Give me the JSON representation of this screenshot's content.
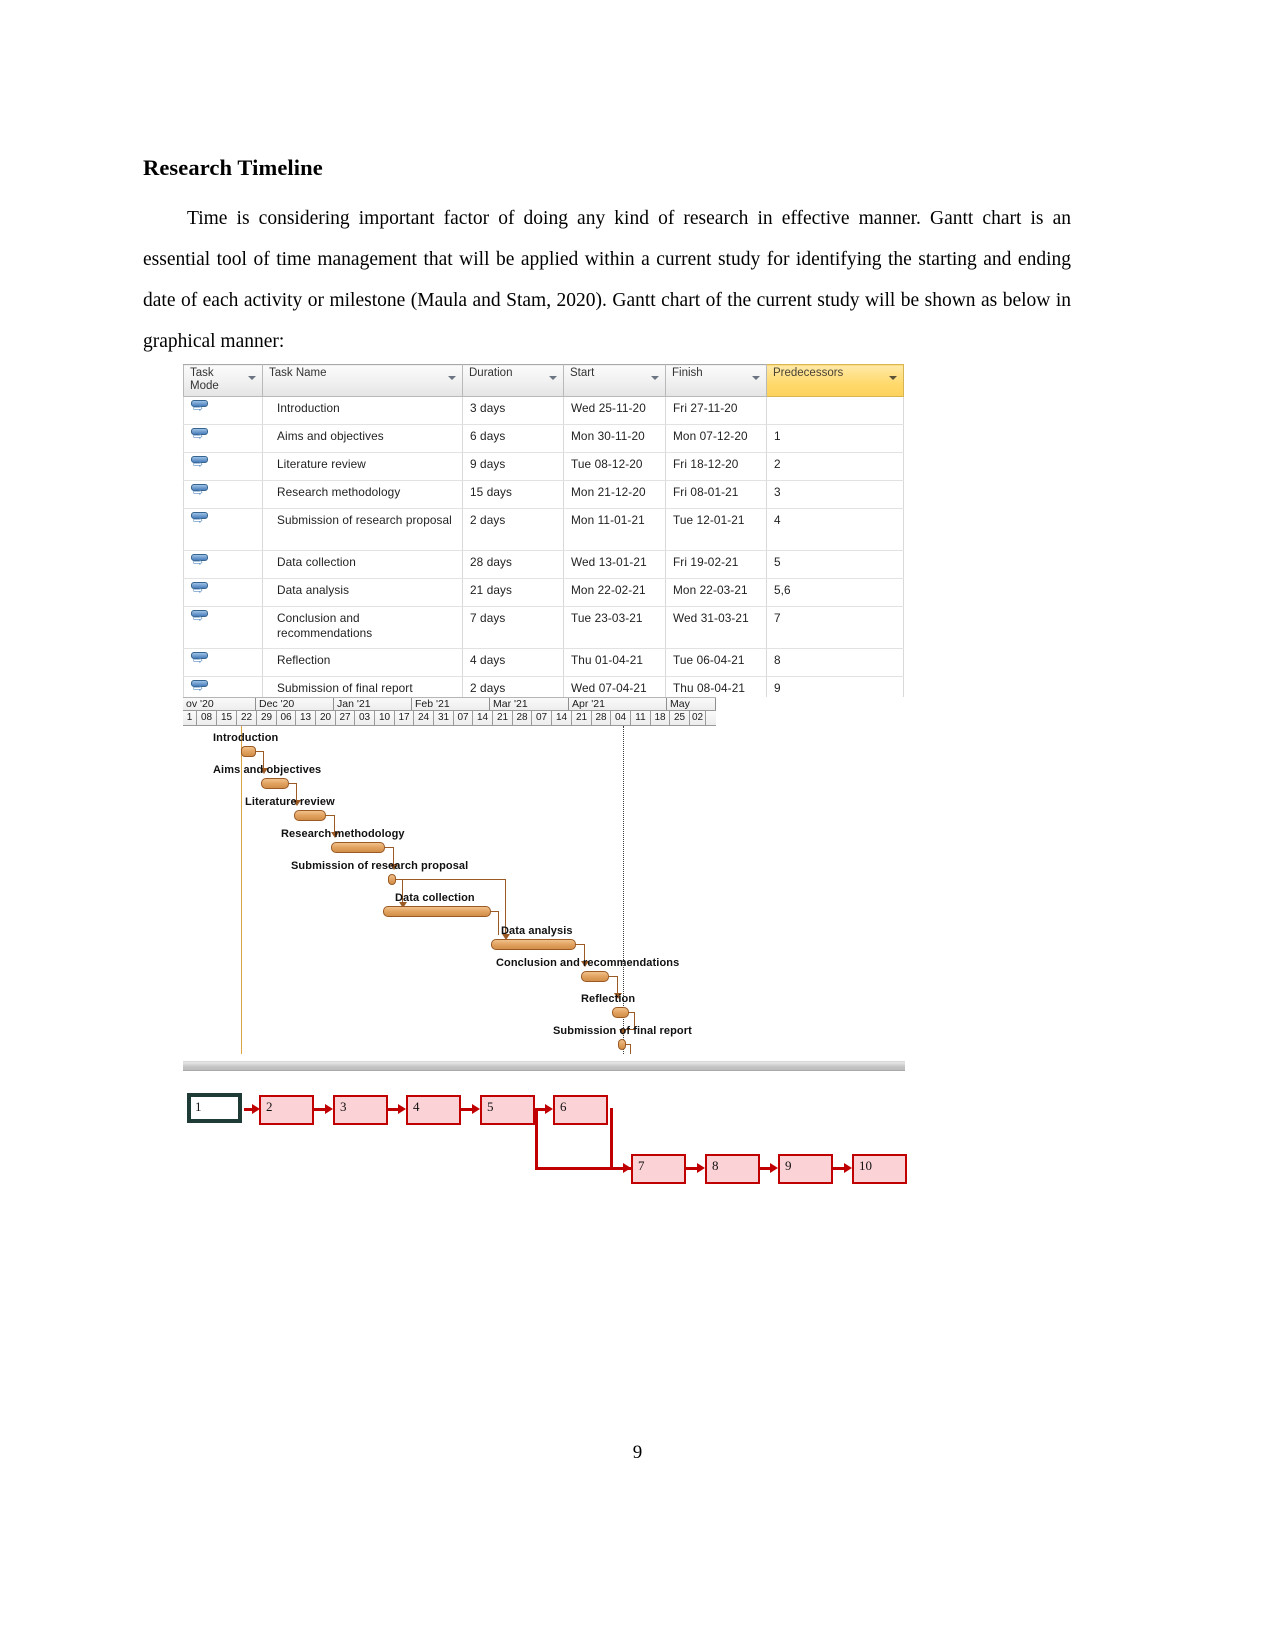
{
  "document": {
    "heading": "Research Timeline",
    "paragraph": "Time is considering important factor of doing any kind of research in effective manner. Gantt chart is an essential tool of time management that will be applied within a current study for identifying the starting and ending date of each activity or milestone (Maula and Stam, 2020). Gantt chart of the current study will be shown as below in graphical manner:",
    "page_number": "9"
  },
  "project_table": {
    "columns": [
      {
        "label": "Task\nMode",
        "filter_icon": "chevron-down-icon"
      },
      {
        "label": "Task Name",
        "filter_icon": "chevron-down-icon"
      },
      {
        "label": "Duration",
        "filter_icon": "chevron-down-icon"
      },
      {
        "label": "Start",
        "filter_icon": "chevron-down-icon"
      },
      {
        "label": "Finish",
        "filter_icon": "chevron-down-icon"
      },
      {
        "label": "Predecessors",
        "filter_icon": "chevron-down-icon"
      }
    ],
    "highlight_column_color": "#ffd96b",
    "rows": [
      {
        "mode_icon": "auto-schedule-icon",
        "name": "Introduction",
        "duration": "3 days",
        "start": "Wed 25-11-20",
        "finish": "Fri 27-11-20",
        "predecessors": ""
      },
      {
        "mode_icon": "auto-schedule-icon",
        "name": "Aims and objectives",
        "duration": "6 days",
        "start": "Mon 30-11-20",
        "finish": "Mon 07-12-20",
        "predecessors": "1"
      },
      {
        "mode_icon": "auto-schedule-icon",
        "name": "Literature review",
        "duration": "9 days",
        "start": "Tue 08-12-20",
        "finish": "Fri 18-12-20",
        "predecessors": "2"
      },
      {
        "mode_icon": "auto-schedule-icon",
        "name": "Research methodology",
        "duration": "15 days",
        "start": "Mon 21-12-20",
        "finish": "Fri 08-01-21",
        "predecessors": "3"
      },
      {
        "mode_icon": "auto-schedule-icon",
        "name": "Submission of research proposal",
        "duration": "2 days",
        "start": "Mon 11-01-21",
        "finish": "Tue 12-01-21",
        "predecessors": "4"
      },
      {
        "mode_icon": "auto-schedule-icon",
        "name": "Data collection",
        "duration": "28 days",
        "start": "Wed 13-01-21",
        "finish": "Fri 19-02-21",
        "predecessors": "5"
      },
      {
        "mode_icon": "auto-schedule-icon",
        "name": "Data analysis",
        "duration": "21 days",
        "start": "Mon 22-02-21",
        "finish": "Mon 22-03-21",
        "predecessors": "5,6"
      },
      {
        "mode_icon": "auto-schedule-icon",
        "name": "Conclusion and recommendations",
        "duration": "7 days",
        "start": "Tue 23-03-21",
        "finish": "Wed 31-03-21",
        "predecessors": "7"
      },
      {
        "mode_icon": "auto-schedule-icon",
        "name": "Reflection",
        "duration": "4 days",
        "start": "Thu 01-04-21",
        "finish": "Tue 06-04-21",
        "predecessors": "8"
      },
      {
        "mode_icon": "auto-schedule-icon",
        "name": "Submission of final report",
        "duration": "2 days",
        "start": "Wed 07-04-21",
        "finish": "Thu 08-04-21",
        "predecessors": "9"
      }
    ]
  },
  "chart_data": {
    "type": "bar",
    "subtype": "gantt",
    "title": "Research Timeline Gantt Chart",
    "xlabel": "",
    "ylabel": "",
    "grid": false,
    "legend": "none",
    "timescale": {
      "months": [
        "ov '20",
        "Dec '20",
        "Jan '21",
        "Feb '21",
        "Mar '21",
        "Apr '21",
        "May"
      ],
      "weeks": [
        "1",
        "08",
        "15",
        "22",
        "29",
        "06",
        "13",
        "20",
        "27",
        "03",
        "10",
        "17",
        "24",
        "31",
        "07",
        "14",
        "21",
        "28",
        "07",
        "14",
        "21",
        "28",
        "04",
        "11",
        "18",
        "25",
        "02"
      ]
    },
    "bar_color": "#e3a564",
    "link_color": "#9b5a24",
    "tasks": [
      {
        "id": 1,
        "label": "Introduction",
        "start": "Wed 25-11-20",
        "finish": "Fri 27-11-20",
        "duration_days": 3,
        "predecessors": []
      },
      {
        "id": 2,
        "label": "Aims and objectives",
        "start": "Mon 30-11-20",
        "finish": "Mon 07-12-20",
        "duration_days": 6,
        "predecessors": [
          1
        ]
      },
      {
        "id": 3,
        "label": "Literature review",
        "start": "Tue 08-12-20",
        "finish": "Fri 18-12-20",
        "duration_days": 9,
        "predecessors": [
          2
        ]
      },
      {
        "id": 4,
        "label": "Research methodology",
        "start": "Mon 21-12-20",
        "finish": "Fri 08-01-21",
        "duration_days": 15,
        "predecessors": [
          3
        ]
      },
      {
        "id": 5,
        "label": "Submission of research proposal",
        "start": "Mon 11-01-21",
        "finish": "Tue 12-01-21",
        "duration_days": 2,
        "predecessors": [
          4
        ]
      },
      {
        "id": 6,
        "label": "Data collection",
        "start": "Wed 13-01-21",
        "finish": "Fri 19-02-21",
        "duration_days": 28,
        "predecessors": [
          5
        ]
      },
      {
        "id": 7,
        "label": "Data analysis",
        "start": "Mon 22-02-21",
        "finish": "Mon 22-03-21",
        "duration_days": 21,
        "predecessors": [
          5,
          6
        ]
      },
      {
        "id": 8,
        "label": "Conclusion and recommendations",
        "start": "Tue 23-03-21",
        "finish": "Wed 31-03-21",
        "duration_days": 7,
        "predecessors": [
          7
        ]
      },
      {
        "id": 9,
        "label": "Reflection",
        "start": "Thu 01-04-21",
        "finish": "Tue 06-04-21",
        "duration_days": 4,
        "predecessors": [
          8
        ]
      },
      {
        "id": 10,
        "label": "Submission of final report",
        "start": "Wed 07-04-21",
        "finish": "Thu 08-04-21",
        "duration_days": 2,
        "predecessors": [
          9
        ]
      }
    ]
  },
  "network_diagram": {
    "node_fill": "#fbd2d6",
    "node_border": "#c00000",
    "selected_border": "#1f3b36",
    "nodes": [
      {
        "label": "1",
        "selected": true
      },
      {
        "label": "2",
        "selected": false
      },
      {
        "label": "3",
        "selected": false
      },
      {
        "label": "4",
        "selected": false
      },
      {
        "label": "5",
        "selected": false
      },
      {
        "label": "6",
        "selected": false
      },
      {
        "label": "7",
        "selected": false
      },
      {
        "label": "8",
        "selected": false
      },
      {
        "label": "9",
        "selected": false
      },
      {
        "label": "10",
        "selected": false
      }
    ],
    "edges": [
      {
        "from": "1",
        "to": "2"
      },
      {
        "from": "2",
        "to": "3"
      },
      {
        "from": "3",
        "to": "4"
      },
      {
        "from": "4",
        "to": "5"
      },
      {
        "from": "5",
        "to": "6"
      },
      {
        "from": "5",
        "to": "7"
      },
      {
        "from": "6",
        "to": "7"
      },
      {
        "from": "7",
        "to": "8"
      },
      {
        "from": "8",
        "to": "9"
      },
      {
        "from": "9",
        "to": "10"
      }
    ]
  }
}
